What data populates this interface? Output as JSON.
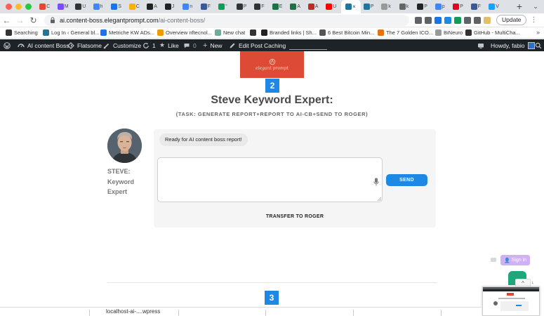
{
  "browser": {
    "tabs": [
      {
        "icon": "gmail-icon",
        "color": "#ea4335",
        "label": "C"
      },
      {
        "icon": "grid-icon",
        "color": "#7c4dff",
        "label": "M"
      },
      {
        "icon": "github-icon",
        "color": "#333333",
        "label": "U"
      },
      {
        "icon": "google-icon",
        "color": "#4285f4",
        "label": "fı"
      },
      {
        "icon": "app-icon",
        "color": "#1a73e8",
        "label": "S"
      },
      {
        "icon": "bolt-icon",
        "color": "#f4b400",
        "label": "C"
      },
      {
        "icon": "a-icon",
        "color": "#222222",
        "label": "A"
      },
      {
        "icon": "a-icon",
        "color": "#222222",
        "label": "J"
      },
      {
        "icon": "google-icon",
        "color": "#4285f4",
        "label": "n"
      },
      {
        "icon": "flag-icon",
        "color": "#3b5998",
        "label": "F"
      },
      {
        "icon": "sheet-icon",
        "color": "#0f9d58",
        "label": "“"
      },
      {
        "icon": "github-icon",
        "color": "#333333",
        "label": "P"
      },
      {
        "icon": "github-icon",
        "color": "#333333",
        "label": "F"
      },
      {
        "icon": "excel-icon",
        "color": "#1e7145",
        "label": "E"
      },
      {
        "icon": "a-icon",
        "color": "#1e7145",
        "label": "A"
      },
      {
        "icon": "a-icon",
        "color": "#c62828",
        "label": "A"
      },
      {
        "icon": "youtube-icon",
        "color": "#ff0000",
        "label": "U"
      },
      {
        "icon": "wp-icon",
        "color": "#21759b",
        "label": "×",
        "active": true
      },
      {
        "icon": "wp-icon",
        "color": "#21759b",
        "label": "P"
      },
      {
        "icon": "page-icon",
        "color": "#999999",
        "label": "k"
      },
      {
        "icon": "globe-icon",
        "color": "#666666",
        "label": "k"
      },
      {
        "icon": "notion-icon",
        "color": "#222222",
        "label": "P"
      },
      {
        "icon": "google-icon",
        "color": "#4285f4",
        "label": "p"
      },
      {
        "icon": "pinterest-icon",
        "color": "#e60023",
        "label": "P"
      },
      {
        "icon": "flag-icon",
        "color": "#3b5998",
        "label": "F"
      },
      {
        "icon": "twitter-icon",
        "color": "#1da1f2",
        "label": "V"
      }
    ],
    "url_host": "ai.content-boss.elegantprompt.com",
    "url_path": "/ai-content-boss/",
    "update_label": "Update",
    "extensions": [
      {
        "icon": "share-icon",
        "color": "#5f6368"
      },
      {
        "icon": "star-icon",
        "color": "#5f6368"
      },
      {
        "icon": "translate-icon",
        "color": "#1a73e8"
      },
      {
        "icon": "shield-icon",
        "color": "#1e88e5"
      },
      {
        "icon": "gear-icon",
        "color": "#0f9d58"
      },
      {
        "icon": "puzzle-icon",
        "color": "#5f6368"
      },
      {
        "icon": "sidebar-icon",
        "color": "#5f6368"
      },
      {
        "icon": "avatar-icon",
        "color": "#e0c068"
      }
    ],
    "bookmarks": [
      {
        "label": "Searching",
        "icon": "github-icon",
        "color": "#333333"
      },
      {
        "label": "Log In ‹ General bl...",
        "icon": "wp-icon",
        "color": "#21759b"
      },
      {
        "label": "Metriche KW ADs...",
        "icon": "chart-icon",
        "color": "#1a73e8"
      },
      {
        "label": "Overview nftecnol...",
        "icon": "overview-icon",
        "color": "#f29900"
      },
      {
        "label": "New chat",
        "icon": "chat-icon",
        "color": "#74aa9c"
      },
      {
        "label": "",
        "icon": "openai-icon",
        "color": "#333333"
      },
      {
        "label": "Branded links | Sh...",
        "icon": "link-icon",
        "color": "#222222"
      },
      {
        "label": "6 Best Bitcoin Min...",
        "icon": "pick-icon",
        "color": "#555555"
      },
      {
        "label": "The 7 Golden ICO...",
        "icon": "c-icon",
        "color": "#e8710a"
      },
      {
        "label": "BiNeuro",
        "icon": "dot-icon",
        "color": "#999999"
      },
      {
        "label": "GitHub - MultiCha...",
        "icon": "github-icon",
        "color": "#333333"
      }
    ]
  },
  "wp_admin_bar": {
    "site_name": "AI content Boss",
    "theme": "Flatsome",
    "customize": "Customize",
    "updates_count": "1",
    "like": "Like",
    "comments_count": "0",
    "new": "New",
    "edit_post": "Edit Post",
    "caching": "Caching",
    "howdy": "Howdy, fabio"
  },
  "page": {
    "logo_text": "elegant prompt",
    "step2_number": "2",
    "expert_title": "Steve Keyword Expert:",
    "task_text": "(TASK: GENERATE REPORT+REPORT TO AI-CB+SEND TO ROGER)",
    "agent_name": "STEVE: Keyword Expert",
    "agent_name_lines": [
      "STEVE:",
      "Keyword",
      "Expert"
    ],
    "chat_bubble": "Ready for AI content boss report!",
    "message_value": "",
    "send_label": "SEND",
    "transfer_label": "TRANSFER TO ROGER",
    "step3_number": "3",
    "signin_label": "Sign in"
  },
  "downloads": {
    "item_label": "localhost-ai-....wpress"
  },
  "colors": {
    "accent_blue": "#1e88e5",
    "logo_red": "#dd4a35",
    "wp_bar": "#1d2327",
    "panel_bg": "#f5f5f5",
    "signin_purple": "#c9a4f5",
    "fab_green": "#1fa67a"
  }
}
